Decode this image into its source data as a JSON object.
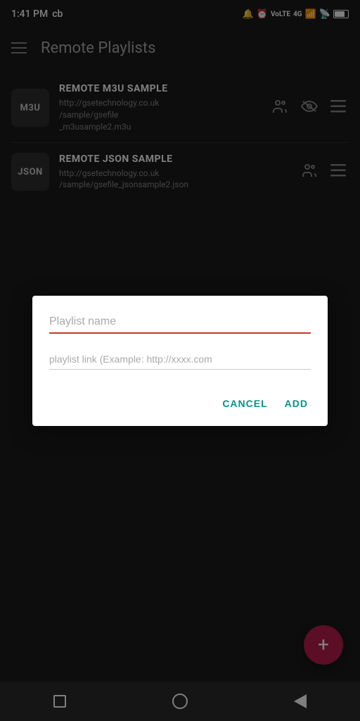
{
  "statusBar": {
    "time": "1:41 PM",
    "carrier": "cb",
    "icons": [
      "alarm",
      "clock",
      "volte",
      "4g",
      "signal",
      "wifi",
      "battery"
    ]
  },
  "topBar": {
    "menuLabel": "menu",
    "title": "Remote Playlists"
  },
  "playlists": [
    {
      "id": "m3u",
      "badge": "M3U",
      "name": "REMOTE M3U SAMPLE",
      "url": "http://gsetechnology.co.uk/sample/gsefile_m3usample2.m3u",
      "hasEye": true
    },
    {
      "id": "json",
      "badge": "JSON",
      "name": "REMOTE JSON SAMPLE",
      "url": "http://gsetechnology.co.uk/sample/gsefile_jsonsample2.json",
      "hasEye": false
    }
  ],
  "dialog": {
    "nameLabel": "Playlist name",
    "namePlaceholder": "Playlist name",
    "linkPlaceholder": "playlist link (Example: http://xxxx.com",
    "cancelLabel": "CANCEL",
    "addLabel": "ADD"
  },
  "fab": {
    "label": "+"
  }
}
